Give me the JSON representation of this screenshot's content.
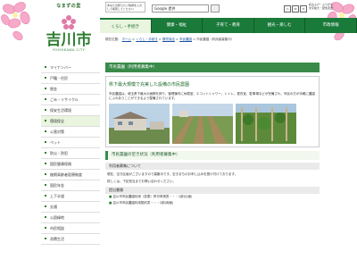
{
  "header": {
    "tagline": "なまずの里",
    "city_name": "吉川市",
    "city_roman": "YOSHIKAWA CITY",
    "util_note": "あなたの知りたい情報を入力して検索してください",
    "search_placeholder": "Google 提供",
    "size_buttons": [
      "小",
      "中",
      "大"
    ],
    "util_links": [
      "読み上げ・ふりがな",
      "文字拡大・配色変更"
    ]
  },
  "gnav": [
    {
      "label": "くらし・手続き",
      "active": true
    },
    {
      "label": "健康・福祉",
      "active": false
    },
    {
      "label": "子育て・教育",
      "active": false
    },
    {
      "label": "観光・楽しむ",
      "active": false
    },
    {
      "label": "市政情報",
      "active": false
    }
  ],
  "breadcrumb": {
    "prefix": "現在位置：",
    "items": [
      "ホーム",
      "くらし・手続き",
      "環境保全",
      "市民農園"
    ],
    "separator": " > ",
    "current": "市民農園（利用者募集中）"
  },
  "sidebar": {
    "items": [
      {
        "label": "マイナンバー",
        "active": false
      },
      {
        "label": "戸籍・住民",
        "active": false
      },
      {
        "label": "税金",
        "active": false
      },
      {
        "label": "ごみ・リサイクル",
        "active": false
      },
      {
        "label": "保安生活環境",
        "active": false
      },
      {
        "label": "環境保全",
        "active": true
      },
      {
        "label": "公害対策",
        "active": false
      },
      {
        "label": "ペット",
        "active": false
      },
      {
        "label": "防災・防犯",
        "active": false
      },
      {
        "label": "国民健康保険",
        "active": false
      },
      {
        "label": "後期高齢者医療制度",
        "active": false
      },
      {
        "label": "国民年金",
        "active": false
      },
      {
        "label": "上下水道",
        "active": false
      },
      {
        "label": "交通",
        "active": false
      },
      {
        "label": "公園緑地",
        "active": false
      },
      {
        "label": "市民相談",
        "active": false
      },
      {
        "label": "消費生活",
        "active": false
      }
    ]
  },
  "main": {
    "page_title": "市民農園（利用者募集中）",
    "feature_heading": "県下最大規模で充実した設備の市民農園",
    "feature_body": "市民農園は、埼玉県下最大の面積を誇り、管理棟内に休憩室、エコットシャワー、トイレ、更衣室、駐車場などが完備され、市民の方が手軽に農園にふれあうことができるよう整備されています。",
    "status_heading": "市民農園の空き状況（利用者募集中）",
    "recruit_heading": "利用者募集について",
    "recruit_text_1": "現在、空き区画がございますので募集中です。空きまちのお申し込みを受け付けております。",
    "recruit_text_2": "詳しくは、下記担当までお問い合わせください。",
    "docs_heading": "提出書類",
    "docs": [
      "吉川市市民農園利用（変更）許可申請書・・・1部(片面)",
      "吉川市市民農園利用契約書・・・2部(両面)"
    ]
  },
  "colors": {
    "brand_green": "#1a7a3a",
    "title_bar": "#3a8a4a",
    "light_green": "#e9f5df",
    "link_blue": "#1a4fa0"
  }
}
